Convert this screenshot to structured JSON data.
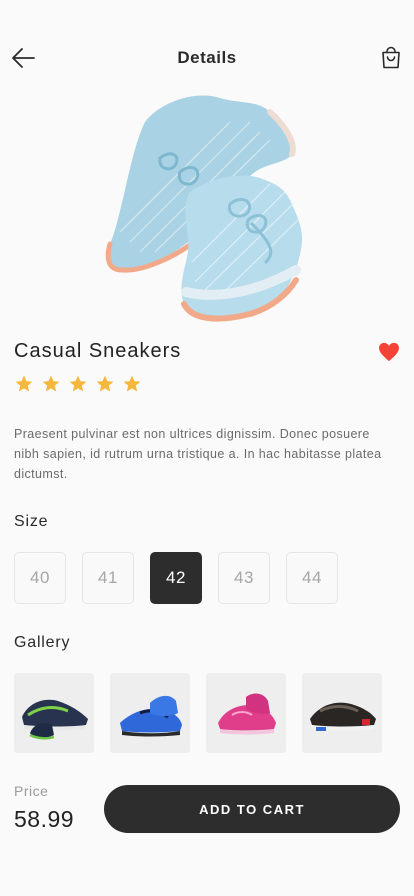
{
  "header": {
    "title": "Details",
    "back_icon": "arrow-left-icon",
    "cart_icon": "shopping-bag-icon"
  },
  "product": {
    "name": "Casual Sneakers",
    "favorite": true,
    "rating": 5,
    "rating_max": 5,
    "description": "Praesent pulvinar est non ultrices dignissim. Donec posuere nibh sapien, id rutrum urna tristique a. In hac habitasse platea dictumst.",
    "hero_image": "light-blue-knit-sneakers"
  },
  "size": {
    "label": "Size",
    "options": [
      "40",
      "41",
      "42",
      "43",
      "44"
    ],
    "selected": "42"
  },
  "gallery": {
    "label": "Gallery",
    "items": [
      "navy-green-running-shoes",
      "blue-running-shoes",
      "pink-running-shoes",
      "black-red-sneakers"
    ]
  },
  "footer": {
    "price_label": "Price",
    "price": "58.99",
    "cta_label": "ADD TO CART"
  },
  "colors": {
    "accent_dark": "#2d2d2d",
    "star": "#f5b83d",
    "favorite": "#f44336",
    "muted_text": "#a6a6a6"
  }
}
